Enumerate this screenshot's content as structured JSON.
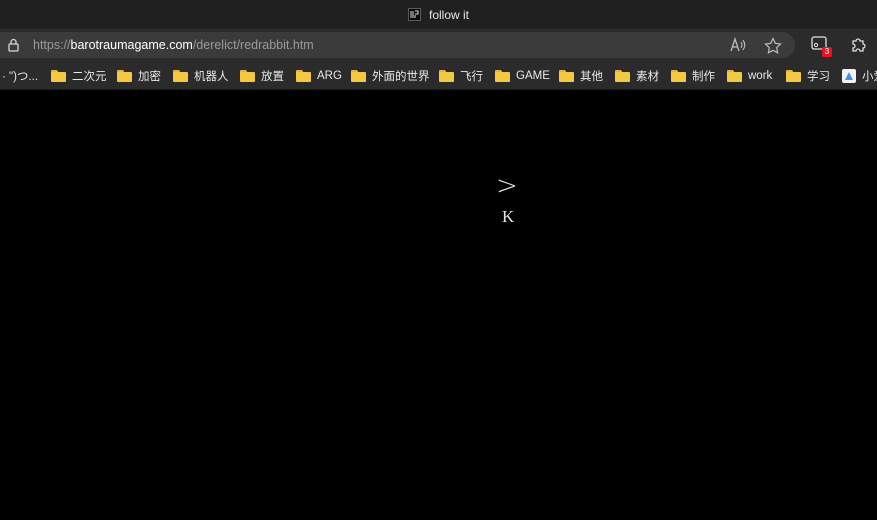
{
  "window": {
    "tab_title": "follow it",
    "tab_icon": "favicon-icon"
  },
  "address_bar": {
    "url_prefix": "https://",
    "url_host": "barotraumagame.com",
    "url_path": "/derelict/redrabbit.htm",
    "extension_badge": "3"
  },
  "bookmarks": [
    {
      "label": "· \")つ...",
      "icon": "none"
    },
    {
      "label": "二次元",
      "icon": "folder-icon"
    },
    {
      "label": "加密",
      "icon": "folder-icon"
    },
    {
      "label": "机器人",
      "icon": "folder-icon"
    },
    {
      "label": "放置",
      "icon": "folder-icon"
    },
    {
      "label": "ARG",
      "icon": "folder-icon"
    },
    {
      "label": "外面的世界",
      "icon": "folder-icon"
    },
    {
      "label": "飞行",
      "icon": "folder-icon"
    },
    {
      "label": "GAME",
      "icon": "folder-icon"
    },
    {
      "label": "其他",
      "icon": "folder-icon"
    },
    {
      "label": "素材",
      "icon": "folder-icon"
    },
    {
      "label": "制作",
      "icon": "folder-icon"
    },
    {
      "label": "work",
      "icon": "folder-icon"
    },
    {
      "label": "学习",
      "icon": "folder-icon"
    },
    {
      "label": "小爱",
      "icon": "app-icon"
    }
  ],
  "page": {
    "arrow": ">",
    "letter": "K",
    "background": "#000000",
    "text_color": "#e6e6e6"
  }
}
